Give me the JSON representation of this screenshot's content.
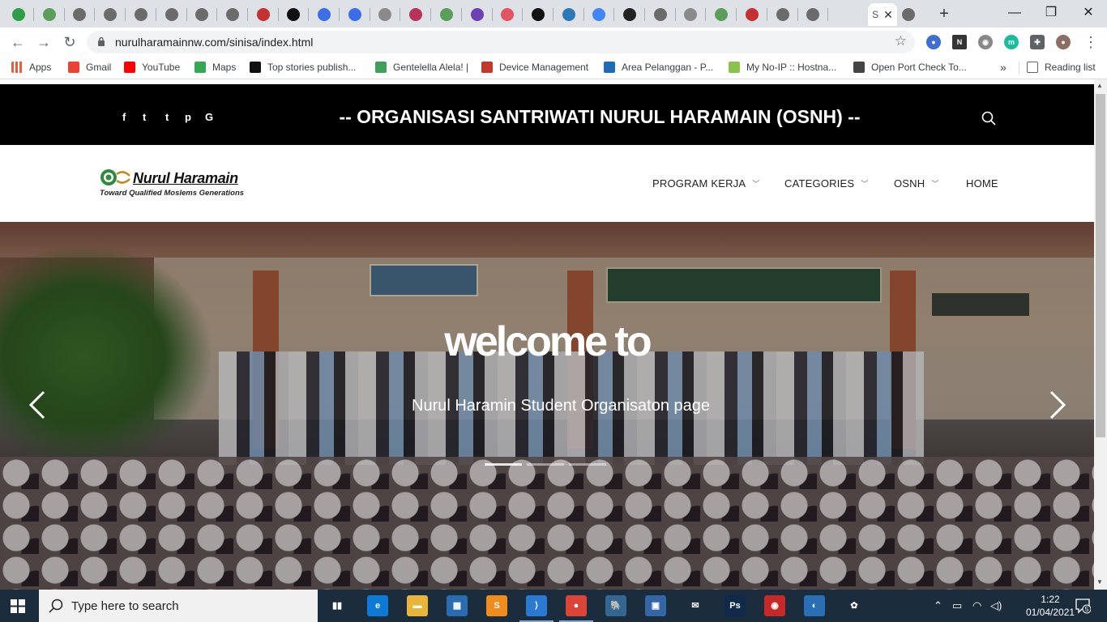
{
  "browser": {
    "tabs": [
      {
        "color": "#2e9e46"
      },
      {
        "color": "#5b9d5b"
      },
      {
        "color": "#6b6b6b"
      },
      {
        "color": "#6b6b6b"
      },
      {
        "color": "#6b6b6b"
      },
      {
        "color": "#6b6b6b"
      },
      {
        "color": "#6b6b6b"
      },
      {
        "color": "#6b6b6b"
      },
      {
        "color": "#c53030"
      },
      {
        "color": "#111111"
      },
      {
        "color": "#3b6ee8"
      },
      {
        "color": "#3b6ee8"
      },
      {
        "color": "#8a8a8a"
      },
      {
        "color": "#b8325a"
      },
      {
        "color": "#5b9d5b"
      },
      {
        "color": "#6f3fb5"
      },
      {
        "color": "#e0555f"
      },
      {
        "color": "#111111"
      },
      {
        "color": "#2c78b8"
      },
      {
        "color": "#4285f4"
      },
      {
        "color": "#222222"
      },
      {
        "color": "#6b6b6b"
      },
      {
        "color": "#8a8a8a"
      },
      {
        "color": "#5b9d5b"
      },
      {
        "color": "#c53030"
      },
      {
        "color": "#6b6b6b"
      },
      {
        "color": "#6b6b6b"
      },
      {
        "color": "#6b6b6b"
      }
    ],
    "active_tab_label": "S",
    "new_tab": "+",
    "window": {
      "minimize": "—",
      "restore": "❐",
      "close": "✕"
    },
    "url": "nurulharamainnw.com/sinisa/index.html"
  },
  "bookmarks": [
    {
      "label": "Apps",
      "color": "#e85d3f"
    },
    {
      "label": "Gmail",
      "color": "#ea4335"
    },
    {
      "label": "YouTube",
      "color": "#ff0000"
    },
    {
      "label": "Maps",
      "color": "#34a853"
    },
    {
      "label": "Top stories publish...",
      "color": "#111111"
    },
    {
      "label": "Gentelella Alela! |",
      "color": "#3ea05a"
    },
    {
      "label": "Device Management",
      "color": "#c0392b"
    },
    {
      "label": "Area Pelanggan - P...",
      "color": "#1e6bb8"
    },
    {
      "label": "My No-IP :: Hostna...",
      "color": "#8bc34a"
    },
    {
      "label": "Open Port Check To...",
      "color": "#444444"
    }
  ],
  "bookmarks_more": "»",
  "reading_list": "Reading list",
  "site": {
    "title": "-- ORGANISASI SANTRIWATI NURUL HARAMAIN (OSNH) --",
    "social": [
      "f",
      "t",
      "t",
      "p",
      "G"
    ],
    "logo_name": "Nurul Haramain",
    "logo_tagline": "Toward Qualified Moslems Generations",
    "nav": [
      {
        "label": "PROGRAM KERJA",
        "dropdown": true
      },
      {
        "label": "CATEGORIES",
        "dropdown": true
      },
      {
        "label": "OSNH",
        "dropdown": true
      },
      {
        "label": "HOME",
        "dropdown": false
      }
    ],
    "hero": {
      "title": "welcome to",
      "subtitle": "Nurul Haramin Student Organisaton page"
    }
  },
  "taskbar": {
    "search_placeholder": "Type here to search",
    "apps": [
      {
        "name": "task-view",
        "color": "#1b2c3c",
        "glyph": "▮▮"
      },
      {
        "name": "edge",
        "color": "#0e7ad7",
        "glyph": "e"
      },
      {
        "name": "file-explorer",
        "color": "#e8b43a",
        "glyph": "▬"
      },
      {
        "name": "store",
        "color": "#2b6cb0",
        "glyph": "▦"
      },
      {
        "name": "sublime",
        "color": "#f08c1e",
        "glyph": "S"
      },
      {
        "name": "vscode",
        "color": "#2a7ad3",
        "glyph": "⟩"
      },
      {
        "name": "chrome",
        "color": "#db4437",
        "glyph": "●"
      },
      {
        "name": "postgres",
        "color": "#336791",
        "glyph": "🐘"
      },
      {
        "name": "remote",
        "color": "#3465a4",
        "glyph": "▣"
      },
      {
        "name": "mail",
        "color": "#1b2c3c",
        "glyph": "✉"
      },
      {
        "name": "photoshop",
        "color": "#0f2a4a",
        "glyph": "Ps"
      },
      {
        "name": "app-red",
        "color": "#c62828",
        "glyph": "◉"
      },
      {
        "name": "app-blue",
        "color": "#2a6fb5",
        "glyph": "◐"
      },
      {
        "name": "app-white",
        "color": "#1b2c3c",
        "glyph": "✿"
      }
    ],
    "time": "1:22",
    "date": "01/04/2021",
    "notification_count": "5"
  }
}
